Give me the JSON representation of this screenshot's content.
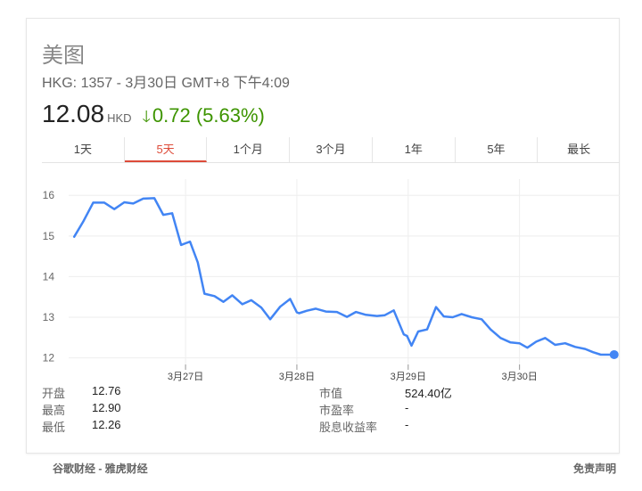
{
  "stock": {
    "name": "美图",
    "meta": "HKG: 1357 - 3月30日 GMT+8 下午4:09",
    "price": "12.08",
    "currency": "HKD",
    "change": "0.72 (5.63%)",
    "change_direction": "down",
    "change_color": "#3d9400"
  },
  "tabs": [
    {
      "label": "1天",
      "active": false
    },
    {
      "label": "5天",
      "active": true
    },
    {
      "label": "1个月",
      "active": false
    },
    {
      "label": "3个月",
      "active": false
    },
    {
      "label": "1年",
      "active": false
    },
    {
      "label": "5年",
      "active": false
    },
    {
      "label": "最长",
      "active": false
    }
  ],
  "chart_data": {
    "type": "line",
    "line_color": "#4285f4",
    "grid": true,
    "ylim": [
      11.75,
      16.4
    ],
    "y_ticks": [
      12,
      13,
      14,
      15,
      16
    ],
    "x_ticks": [
      {
        "label": "3月27日",
        "x": 1
      },
      {
        "label": "3月28日",
        "x": 2
      },
      {
        "label": "3月29日",
        "x": 3
      },
      {
        "label": "3月30日",
        "x": 4
      }
    ],
    "xlim": [
      -0.05,
      4.9
    ],
    "series": [
      {
        "x": [
          0.0,
          0.08,
          0.17,
          0.27,
          0.36,
          0.45,
          0.53,
          0.62,
          0.72,
          0.8,
          0.88,
          0.96,
          1.0,
          1.04,
          1.11,
          1.17,
          1.26,
          1.34,
          1.42,
          1.51,
          1.59,
          1.68,
          1.76,
          1.85,
          1.94,
          2.0,
          2.02,
          2.09,
          2.17,
          2.26,
          2.36,
          2.45,
          2.53,
          2.62,
          2.72,
          2.79,
          2.87,
          2.96,
          2.99,
          3.03,
          3.09,
          3.17,
          3.25,
          3.32,
          3.4,
          3.48,
          3.57,
          3.66,
          3.74,
          3.83,
          3.92,
          4.0,
          4.07,
          4.15,
          4.23,
          4.32,
          4.41,
          4.5,
          4.59,
          4.66,
          4.73,
          4.79,
          4.85
        ],
        "y": [
          14.98,
          15.35,
          15.82,
          15.82,
          15.66,
          15.83,
          15.8,
          15.92,
          15.93,
          15.52,
          15.56,
          14.78,
          14.82,
          14.86,
          14.35,
          13.58,
          13.52,
          13.38,
          13.54,
          13.32,
          13.42,
          13.24,
          12.95,
          13.26,
          13.45,
          13.12,
          13.1,
          13.16,
          13.21,
          13.14,
          13.13,
          13.01,
          13.13,
          13.06,
          13.03,
          13.05,
          13.17,
          12.58,
          12.54,
          12.3,
          12.65,
          12.7,
          13.25,
          13.02,
          13.0,
          13.08,
          13.0,
          12.95,
          12.7,
          12.49,
          12.38,
          12.36,
          12.25,
          12.4,
          12.49,
          12.32,
          12.36,
          12.27,
          12.22,
          12.14,
          12.08,
          12.08,
          12.08
        ]
      }
    ]
  },
  "stats": {
    "left": [
      {
        "label": "开盘",
        "value": "12.76"
      },
      {
        "label": "最高",
        "value": "12.90"
      },
      {
        "label": "最低",
        "value": "12.26"
      }
    ],
    "right": [
      {
        "label": "市值",
        "value": "524.40亿"
      },
      {
        "label": "市盈率",
        "value": "-"
      },
      {
        "label": "股息收益率",
        "value": "-"
      }
    ]
  },
  "footer": {
    "source": "谷歌财经 - 雅虎财经",
    "disclaimer": "免责声明"
  }
}
